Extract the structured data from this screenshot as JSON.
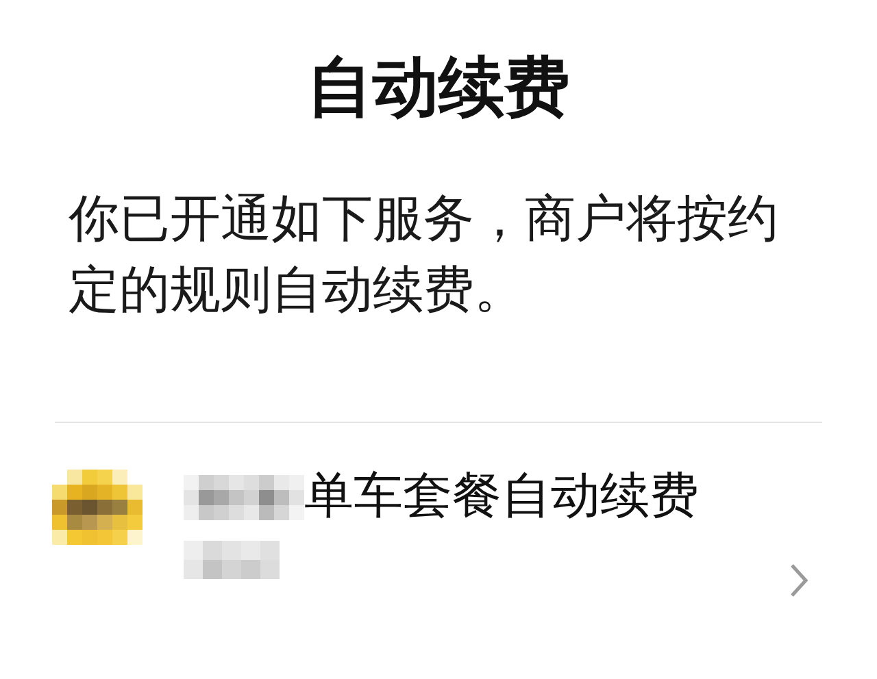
{
  "title": "自动续费",
  "description": "你已开通如下服务，商户将按约定的规则自动续费。",
  "services": [
    {
      "name": "单车套餐自动续费"
    }
  ]
}
